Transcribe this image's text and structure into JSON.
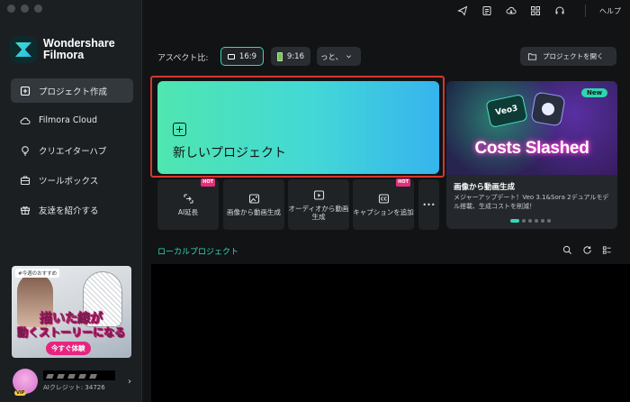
{
  "brand": {
    "line1": "Wondershare",
    "line2": "Filmora"
  },
  "sidebar": {
    "items": [
      {
        "label": "プロジェクト作成",
        "icon": "new-project-icon",
        "active": true
      },
      {
        "label": "Filmora Cloud",
        "icon": "cloud-icon",
        "active": false
      },
      {
        "label": "クリエイターハブ",
        "icon": "lightbulb-icon",
        "active": false
      },
      {
        "label": "ツールボックス",
        "icon": "toolbox-icon",
        "active": false
      },
      {
        "label": "友達を紹介する",
        "icon": "gift-icon",
        "active": false
      }
    ],
    "promo": {
      "tag": "#今週のおすすめ",
      "line1": "描いた線が",
      "line2": "動くストーリーになる",
      "cta": "今すぐ体験"
    },
    "user": {
      "vip": "VIP",
      "credits": "AIクレジット: 34726"
    }
  },
  "topbar": {
    "icons": [
      "send-icon",
      "document-icon",
      "cloud-download-icon",
      "grid-icon",
      "headset-icon"
    ],
    "help": "ヘルプ"
  },
  "aspect": {
    "label": "アスペクト比:",
    "options": [
      "16:9",
      "9:16",
      "っと、"
    ],
    "selected": "16:9"
  },
  "open_project": "プロジェクトを開く",
  "new_project": {
    "title": "新しいプロジェクト"
  },
  "feature": {
    "badge": "New",
    "image_caption": "Costs Slashed",
    "image_logo": "Veo3",
    "title": "画像から動画生成",
    "desc": "メジャーアップデート！Veo 3.1&Sora 2デュアルモデル搭載、生成コストを削減！",
    "slides": 6,
    "active_slide": 0
  },
  "tools": [
    {
      "label": "AI延長",
      "hot": true,
      "icon": "ai-extend-icon"
    },
    {
      "label": "画像から動画生成",
      "hot": false,
      "icon": "image-to-video-icon"
    },
    {
      "label": "オーディオから動画生成",
      "hot": false,
      "icon": "audio-to-video-icon"
    },
    {
      "label": "キャプションを追加",
      "hot": true,
      "icon": "caption-icon"
    },
    {
      "label": "•••",
      "hot": false,
      "icon": "more-icon"
    }
  ],
  "hot_label": "HOT",
  "local": {
    "title": "ローカルプロジェクト",
    "icons": [
      "search-icon",
      "refresh-icon",
      "list-view-icon"
    ]
  },
  "colors": {
    "accent": "#35d8b9",
    "highlight": "#d5382f",
    "hot": "#e42f7b"
  }
}
